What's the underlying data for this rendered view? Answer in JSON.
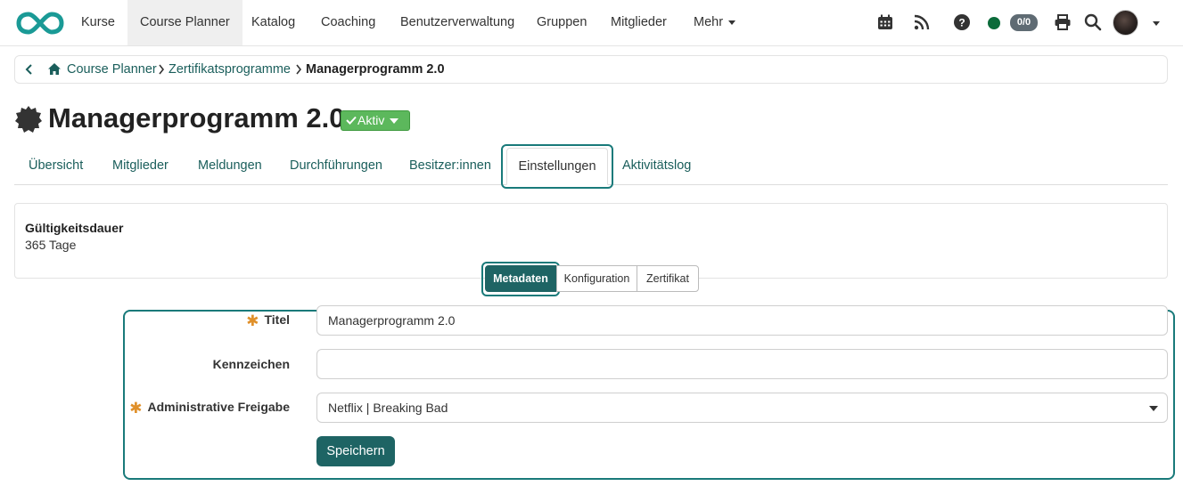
{
  "nav": {
    "items": [
      "Kurse",
      "Course Planner",
      "Katalog",
      "Coaching",
      "Benutzerverwaltung",
      "Gruppen",
      "Mitglieder",
      "Mehr"
    ],
    "active_index": 1,
    "badge": "0/0",
    "icons": [
      "logo-icon",
      "calendar-icon",
      "rss-icon",
      "help-icon",
      "status-dot",
      "print-icon",
      "search-icon",
      "avatar"
    ]
  },
  "breadcrumb": {
    "items": [
      "Course Planner",
      "Zertifikatsprogramme"
    ],
    "current": "Managerprogramm 2.0"
  },
  "page": {
    "title": "Managerprogramm 2.0",
    "status": "Aktiv",
    "status_color": "#5cb85c"
  },
  "tabs": {
    "items": [
      "Übersicht",
      "Mitglieder",
      "Meldungen",
      "Durchführungen",
      "Besitzer:innen",
      "Einstellungen",
      "Aktivitätslog"
    ],
    "active": "Einstellungen"
  },
  "info": {
    "label": "Gültigkeitsdauer",
    "value": "365 Tage"
  },
  "segments": {
    "items": [
      "Metadaten",
      "Konfiguration",
      "Zertifikat"
    ],
    "active": "Metadaten"
  },
  "form": {
    "title_label": "Titel",
    "title_value": "Managerprogramm 2.0",
    "kennzeichen_label": "Kennzeichen",
    "kennzeichen_value": "",
    "freigabe_label": "Administrative Freigabe",
    "freigabe_value": "Netflix | Breaking Bad",
    "save_label": "Speichern"
  },
  "colors": {
    "accent": "#1e6464",
    "link": "#1a5e5b",
    "required": "#e0902a",
    "focus_ring": "#197a7a"
  }
}
